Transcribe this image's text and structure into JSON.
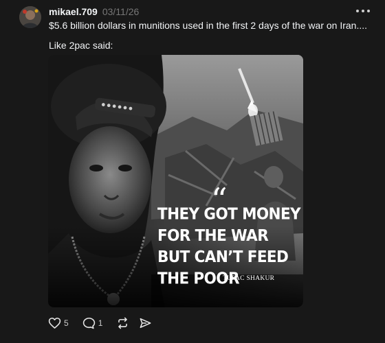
{
  "post": {
    "username": "mikael.709",
    "timestamp": "03/11/26",
    "text_line1": "$5.6 billion dollars in munitions used in the first 2 days of the war on Iran....",
    "text_line2": "Like 2pac said:"
  },
  "image": {
    "quote_mark": "“",
    "quote_lines": [
      "THEY GOT MONEY",
      "FOR THE WAR",
      "BUT CAN’T FEED",
      "THE POOR"
    ],
    "author": "TUPAC SHAKUR"
  },
  "actions": {
    "likes": "5",
    "replies": "1"
  },
  "icons": {
    "more": "more-icon",
    "like": "heart-icon",
    "reply": "comment-icon",
    "repost": "repost-icon",
    "share": "send-icon"
  },
  "colors": {
    "background": "#181818",
    "text": "#f3f5f7",
    "muted": "#777777"
  }
}
